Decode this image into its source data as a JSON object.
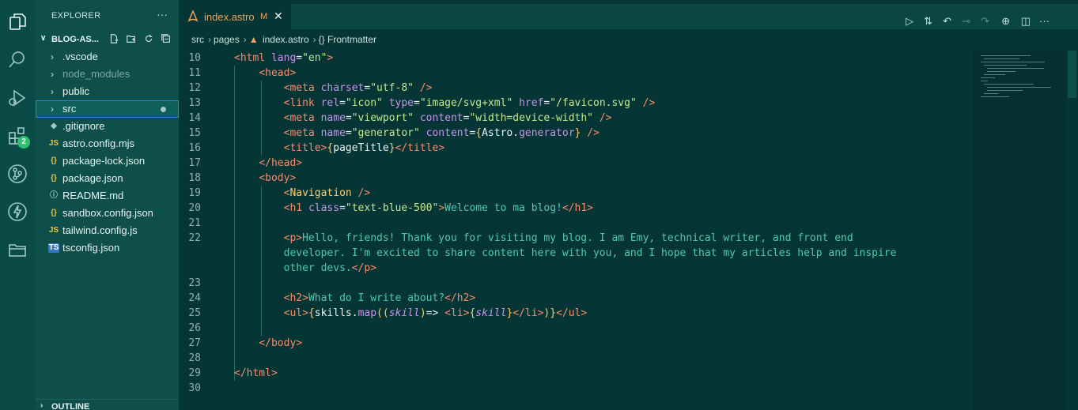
{
  "activity_bar": {
    "icons": [
      "explorer-icon",
      "search-icon",
      "run-debug-icon",
      "extensions-icon",
      "source-control-icon",
      "lightning-icon",
      "folder-icon"
    ],
    "extensions_badge": "2"
  },
  "explorer": {
    "title": "EXPLORER",
    "more": "···",
    "project": "BLOG-AS...",
    "items": [
      {
        "label": ".vscode",
        "kind": "folder"
      },
      {
        "label": "node_modules",
        "kind": "folder"
      },
      {
        "label": "public",
        "kind": "folder"
      },
      {
        "label": "src",
        "kind": "folder"
      },
      {
        "label": ".gitignore",
        "kind": "git"
      },
      {
        "label": "astro.config.mjs",
        "kind": "js",
        "icon": "JS"
      },
      {
        "label": "package-lock.json",
        "kind": "json",
        "icon": "{}"
      },
      {
        "label": "package.json",
        "kind": "json",
        "icon": "{}"
      },
      {
        "label": "README.md",
        "kind": "info",
        "icon": "ⓘ"
      },
      {
        "label": "sandbox.config.json",
        "kind": "json",
        "icon": "{}"
      },
      {
        "label": "tailwind.config.js",
        "kind": "js",
        "icon": "JS"
      },
      {
        "label": "tsconfig.json",
        "kind": "ts",
        "icon": "TS"
      }
    ],
    "outline_label": "OUTLINE"
  },
  "tab": {
    "name": "index.astro",
    "modified": "M",
    "close": "✕"
  },
  "breadcrumb": {
    "parts": [
      "src",
      "pages",
      "index.astro",
      "{} Frontmatter"
    ]
  },
  "colors": {
    "accent": "#1c8fd6",
    "tab_text": "#f0a45d",
    "background": "#063535"
  },
  "editor": {
    "line_numbers": [
      "10",
      "11",
      "12",
      "13",
      "14",
      "15",
      "16",
      "17",
      "18",
      "19",
      "20",
      "21",
      "22",
      "",
      "",
      "23",
      "24",
      "25",
      "26",
      "27",
      "28",
      "29",
      "30"
    ]
  }
}
